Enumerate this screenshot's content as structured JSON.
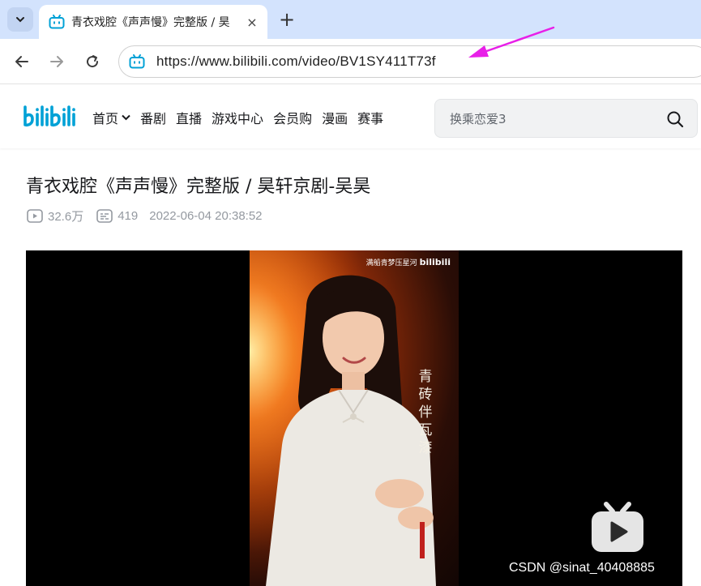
{
  "browser": {
    "tab": {
      "title": "青衣戏腔《声声慢》完整版 / 昊",
      "close_glyph": "×"
    },
    "new_tab_glyph": "+",
    "address_bar": {
      "url": "https://www.bilibili.com/video/BV1SY411T73f"
    },
    "annotation_arrow_color": "#e81fe8"
  },
  "site_header": {
    "logo_text": "bilibili",
    "nav": [
      {
        "label": "首页",
        "has_dropdown": true
      },
      {
        "label": "番剧"
      },
      {
        "label": "直播"
      },
      {
        "label": "游戏中心"
      },
      {
        "label": "会员购"
      },
      {
        "label": "漫画"
      },
      {
        "label": "赛事"
      }
    ],
    "search": {
      "placeholder": "换乘恋爱3",
      "icon": "search-icon"
    },
    "brand_color": "#00a1d6"
  },
  "video": {
    "title": "青衣戏腔《声声慢》完整版 / 昊轩京剧-吴昊",
    "views": "32.6万",
    "danmaku": "419",
    "published": "2022-06-04 20:38:52",
    "overlay_text": "青砖伴瓦漆",
    "frame_brand_text": "满船青梦压星河"
  },
  "watermark": "CSDN @sinat_40408885"
}
